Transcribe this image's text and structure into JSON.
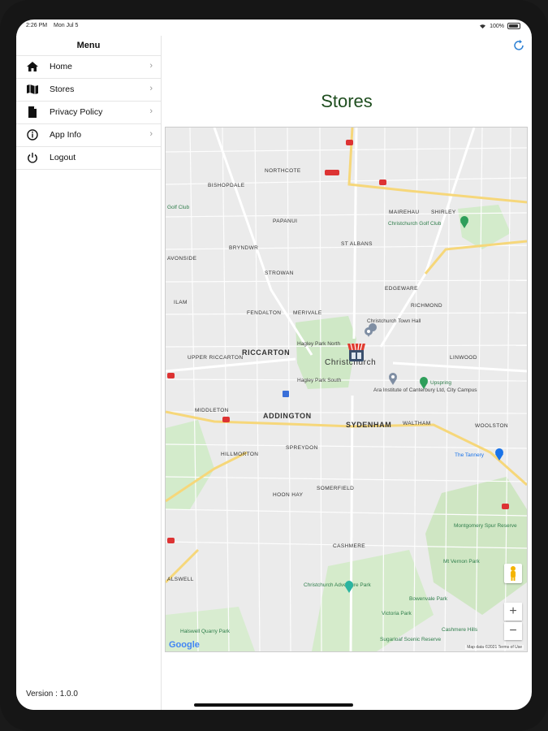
{
  "status_bar": {
    "time": "2:26 PM",
    "date": "Mon Jul 5",
    "battery": "100%"
  },
  "sidebar": {
    "title": "Menu",
    "items": [
      {
        "label": "Home",
        "icon": "home-icon"
      },
      {
        "label": "Stores",
        "icon": "map-icon"
      },
      {
        "label": "Privacy Policy",
        "icon": "document-icon"
      },
      {
        "label": "App Info",
        "icon": "info-icon"
      },
      {
        "label": "Logout",
        "icon": "power-icon"
      }
    ],
    "version": "Version : 1.0.0"
  },
  "main": {
    "title": "Stores",
    "refresh_icon": "refresh-icon"
  },
  "map": {
    "suburbs": [
      "NORTHCOTE",
      "BISHOPDALE",
      "PAPANUI",
      "BRYNDWR",
      "ST ALBANS",
      "STROWAN",
      "EDGEWARE",
      "RICHMOND",
      "MAIREHAU",
      "SHIRLEY",
      "ILAM",
      "FENDALTON",
      "MERIVALE",
      "UPPER RICCARTON",
      "MIDDLETON",
      "HILLMORTON",
      "SPREYDON",
      "HOON HAY",
      "SOMERFIELD",
      "CASHMERE",
      "WALTHAM",
      "WOOLSTON",
      "AVONSIDE",
      "ALSWELL",
      "LINWOOD"
    ],
    "major_labels": [
      "RICCARTON",
      "ADDINGTON",
      "SYDENHAM"
    ],
    "city_label": "Christchurch",
    "pois": [
      "Christchurch Town Hall",
      "Hagley Park North",
      "Hagley Park South",
      "Ara Institute of Canterbury Ltd, City Campus",
      "Upspring",
      "Golf Club",
      "Christchurch Golf Club",
      "The Tannery",
      "Christchurch Adventure Park",
      "Montgomery Spur Reserve",
      "Mt Vernon Park",
      "Bowenvale Park",
      "Victoria Park",
      "Sugarloaf Scenic Reserve",
      "Halswell Quarry Park",
      "Cashmere Hills"
    ],
    "zoom_in": "+",
    "zoom_out": "−",
    "google": "Google",
    "attribution": "Map data ©2021   Terms of Use"
  }
}
